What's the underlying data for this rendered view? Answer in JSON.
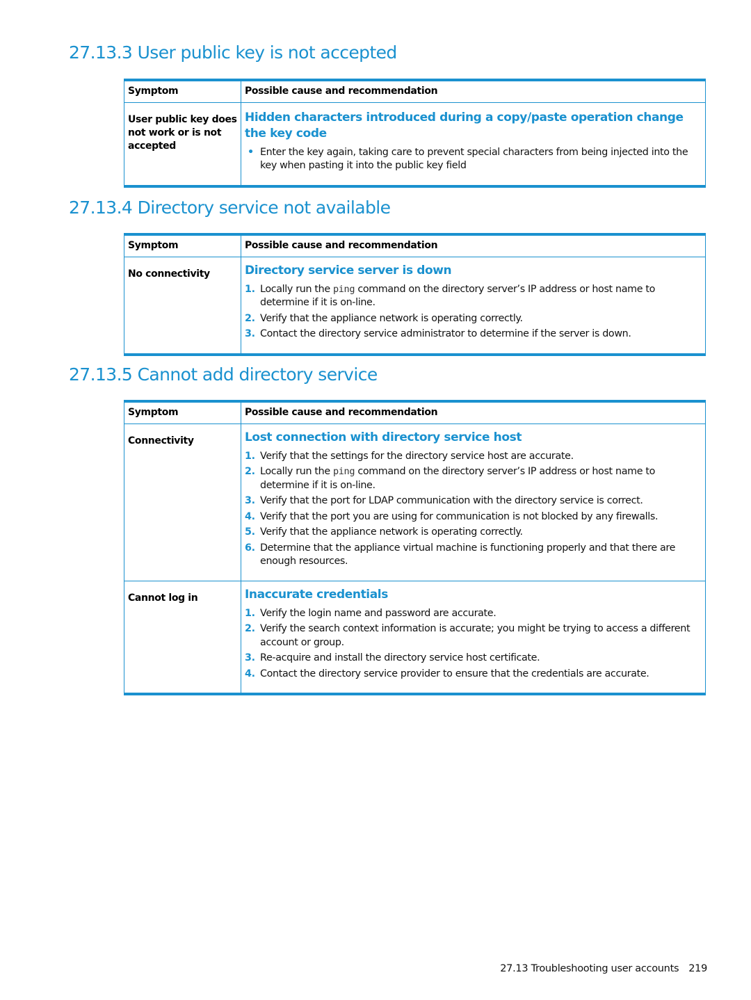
{
  "sections": [
    {
      "heading": "27.13.3 User public key is not accepted",
      "table": {
        "headers": [
          "Symptom",
          "Possible cause and recommendation"
        ],
        "rows": [
          {
            "symptom": "User public key does not work or is not accepted",
            "cause": "Hidden characters introduced during a copy/paste operation change the key code",
            "list_type": "bullet",
            "steps": [
              {
                "text": "Enter the key again, taking care to prevent special characters from being injected into the key when pasting it into the public key field"
              }
            ]
          }
        ]
      }
    },
    {
      "heading": "27.13.4 Directory service not available",
      "table": {
        "headers": [
          "Symptom",
          "Possible cause and recommendation"
        ],
        "rows": [
          {
            "symptom": "No connectivity",
            "cause": "Directory service server is down",
            "list_type": "numbered",
            "steps": [
              {
                "num": "1.",
                "pre": "Locally run the ",
                "code": "ping",
                "post": " command on the directory server’s IP address or host name to determine if it is on-line."
              },
              {
                "num": "2.",
                "text": "Verify that the appliance network is operating correctly."
              },
              {
                "num": "3.",
                "text": "Contact the directory service administrator to determine if the server is down."
              }
            ]
          }
        ]
      }
    },
    {
      "heading": "27.13.5 Cannot add directory service",
      "table": {
        "headers": [
          "Symptom",
          "Possible cause and recommendation"
        ],
        "rows": [
          {
            "symptom": "Connectivity",
            "cause": "Lost connection with directory service host",
            "list_type": "numbered",
            "steps": [
              {
                "num": "1.",
                "text": "Verify that the settings for the directory service host are accurate."
              },
              {
                "num": "2.",
                "pre": "Locally run the ",
                "code": "ping",
                "post": " command on the directory server’s IP address or host name to determine if it is on-line."
              },
              {
                "num": "3.",
                "text": "Verify that the port for LDAP communication with the directory service is correct."
              },
              {
                "num": "4.",
                "text": "Verify that the port you are using for communication is not blocked by any firewalls."
              },
              {
                "num": "5.",
                "text": "Verify that the appliance network is operating correctly."
              },
              {
                "num": "6.",
                "text": "Determine that the appliance virtual machine is functioning properly and that there are enough resources."
              }
            ]
          },
          {
            "symptom": "Cannot log in",
            "cause": "Inaccurate credentials",
            "list_type": "numbered",
            "steps": [
              {
                "num": "1.",
                "text": "Verify the login name and password are accurate."
              },
              {
                "num": "2.",
                "text": "Verify the search context information is accurate; you might be trying to access a different account or group."
              },
              {
                "num": "3.",
                "text": "Re-acquire and install the directory service host certificate."
              },
              {
                "num": "4.",
                "text": "Contact the directory service provider to ensure that the credentials are accurate."
              }
            ]
          }
        ]
      }
    }
  ],
  "footer": {
    "section": "27.13 Troubleshooting user accounts",
    "page": "219"
  },
  "colors": {
    "accent": "#1a91cf",
    "text": "#111111"
  }
}
